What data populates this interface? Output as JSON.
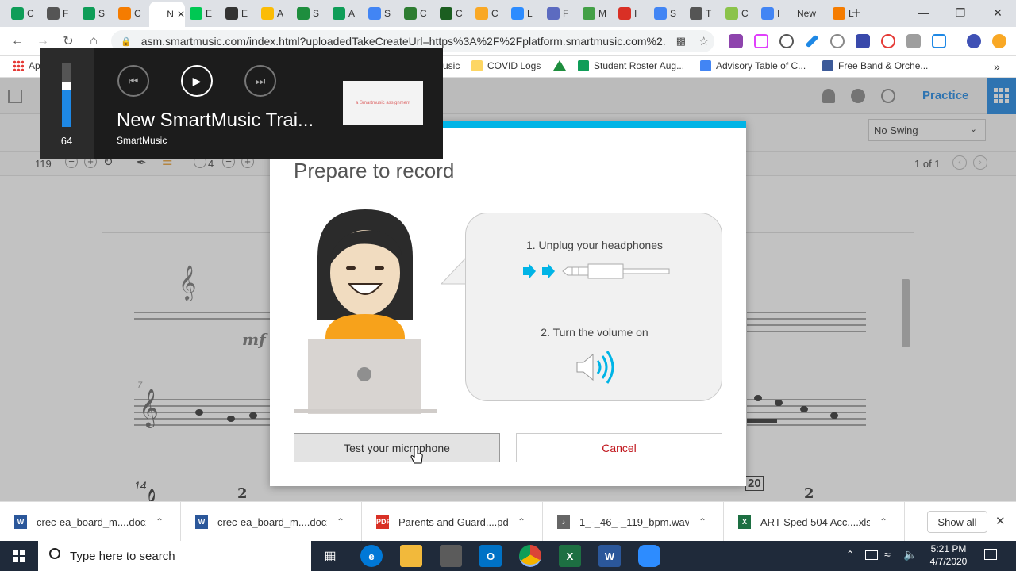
{
  "browser": {
    "tabs": [
      {
        "label": "C",
        "color": "#0f9d58"
      },
      {
        "label": "F",
        "color": "#555555"
      },
      {
        "label": "S",
        "color": "#0f9d58"
      },
      {
        "label": "C",
        "color": "#f57c00"
      },
      {
        "label": "N",
        "color": "#ffffff",
        "active": true
      },
      {
        "label": "E",
        "color": "#00c853"
      },
      {
        "label": "E",
        "color": "#333333"
      },
      {
        "label": "A",
        "color": "#fbbc05"
      },
      {
        "label": "S",
        "color": "#1e8e3e"
      },
      {
        "label": "A",
        "color": "#0f9d58"
      },
      {
        "label": "S",
        "color": "#4285f4"
      },
      {
        "label": "C",
        "color": "#2e7d32"
      },
      {
        "label": "C",
        "color": "#1b5e20"
      },
      {
        "label": "C",
        "color": "#f9a825"
      },
      {
        "label": "L",
        "color": "#2d8cff"
      },
      {
        "label": "F",
        "color": "#5c6bc0"
      },
      {
        "label": "M",
        "color": "#43a047"
      },
      {
        "label": "I",
        "color": "#d93025"
      },
      {
        "label": "S",
        "color": "#4285f4"
      },
      {
        "label": "T",
        "color": "#555555"
      },
      {
        "label": "C",
        "color": "#8bc34a"
      },
      {
        "label": "I",
        "color": "#4285f4"
      },
      {
        "label": "New",
        "color": "#dddddd"
      },
      {
        "label": "L",
        "color": "#f57c00"
      }
    ],
    "close_tab_symbol": "✕",
    "new_tab_symbol": "+",
    "url": "asm.smartmusic.com/index.html?uploadedTakeCreateUrl=https%3A%2F%2Fplatform.smartmusic.com%2...",
    "bookmarks": [
      {
        "label": "Ap",
        "icon": "apps-icon"
      },
      {
        "label": "usic",
        "icon": "none"
      },
      {
        "label": "COVID Logs",
        "icon": "folder-icon"
      },
      {
        "label": "",
        "icon": "google-drive-icon"
      },
      {
        "label": "Student Roster Aug...",
        "icon": "sheets-icon"
      },
      {
        "label": "Advisory Table of C...",
        "icon": "docs-icon"
      },
      {
        "label": "Free Band & Orche...",
        "icon": "site-icon"
      }
    ],
    "more_bookmarks": "»"
  },
  "app": {
    "practice_label": "Practice",
    "swing_select": "No Swing",
    "page_indicator": "1 of 1",
    "tempo": "119",
    "count": "4",
    "score_measures": [
      "7",
      "14",
      "20"
    ],
    "dynamic": "mf",
    "rest_number": "2"
  },
  "media": {
    "volume": "64",
    "volume_level": 0.64,
    "title": "New SmartMusic Trai...",
    "source": "SmartMusic",
    "thumbnail_text": "a Smartmusic assignment"
  },
  "modal": {
    "title": "Prepare to record",
    "step1": "1. Unplug your headphones",
    "step2": "2. Turn the volume on",
    "test_button": "Test your microphone",
    "cancel_button": "Cancel",
    "accent": "#00b4e6"
  },
  "downloads": {
    "items": [
      {
        "name": "crec-ea_board_m....docx",
        "type": "word"
      },
      {
        "name": "crec-ea_board_m....docx",
        "type": "word"
      },
      {
        "name": "Parents and Guard....pdf",
        "type": "pdf"
      },
      {
        "name": "1_-_46_-_119_bpm.wav",
        "type": "audio"
      },
      {
        "name": "ART Sped 504 Acc....xlsx",
        "type": "excel"
      }
    ],
    "show_all": "Show all"
  },
  "taskbar": {
    "search_placeholder": "Type here to search",
    "time": "5:21 PM",
    "date": "4/7/2020"
  }
}
